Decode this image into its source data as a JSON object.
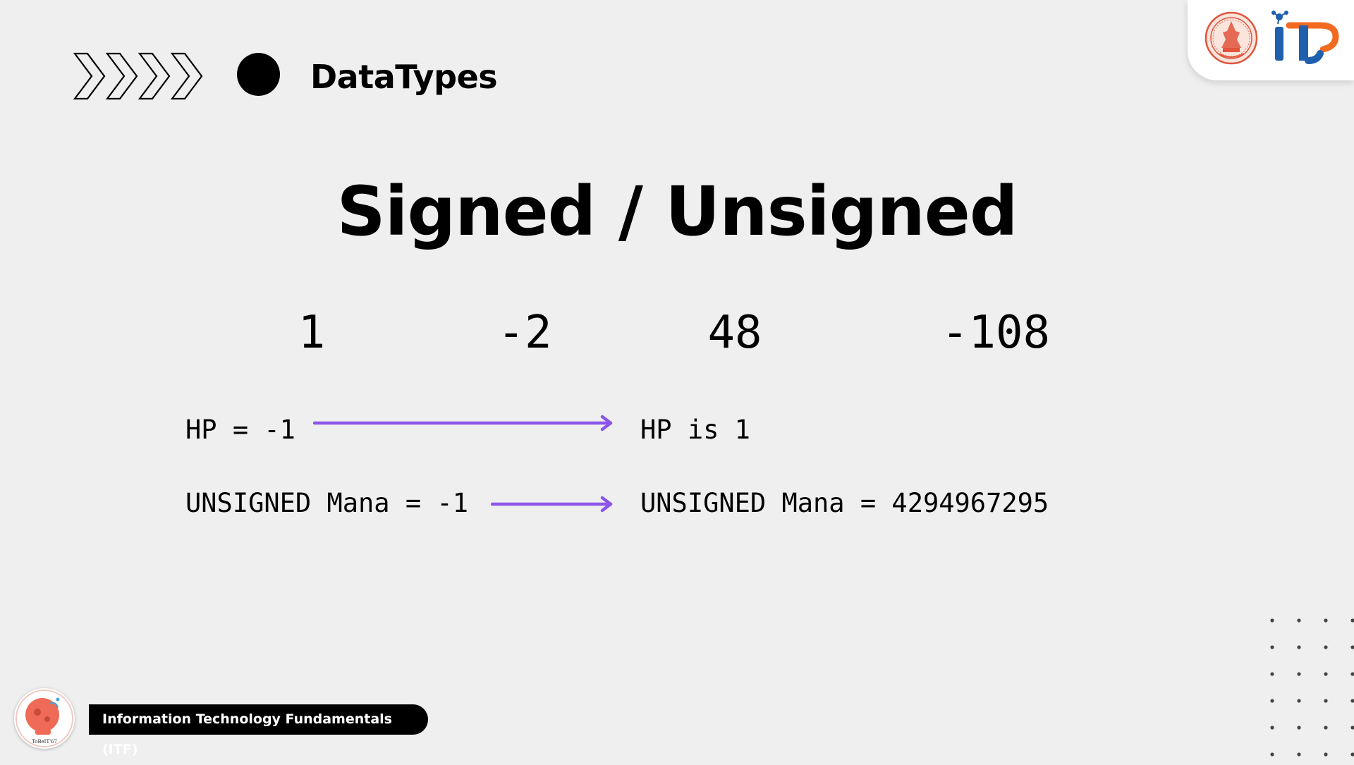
{
  "header": {
    "section_title": "DataTypes",
    "chevrons_icon": "chevrons-right-icon",
    "bullet_icon": "filled-circle-icon"
  },
  "logos": {
    "seal": "university-seal-logo",
    "it": "it-faculty-logo",
    "it_text": "IT",
    "colors": {
      "it_blue": "#1f5fae",
      "it_orange": "#f26a21",
      "seal_red": "#e0553c"
    }
  },
  "slide": {
    "title": "Signed / Unsigned",
    "numbers": [
      "1",
      "-2",
      "48",
      "-108"
    ],
    "examples": [
      {
        "input": "HP = -1",
        "output": "HP is 1"
      },
      {
        "input": "UNSIGNED Mana = -1",
        "output": "UNSIGNED Mana = 4294967295"
      }
    ],
    "arrow_color": "#8b55ea"
  },
  "footer": {
    "course_label": "Information Technology Fundamentals (ITF)",
    "avatar": "course-mascot-avatar",
    "avatar_caption": "ToBeIT'67"
  },
  "decor": {
    "dot_grid": "dot-grid-pattern"
  }
}
